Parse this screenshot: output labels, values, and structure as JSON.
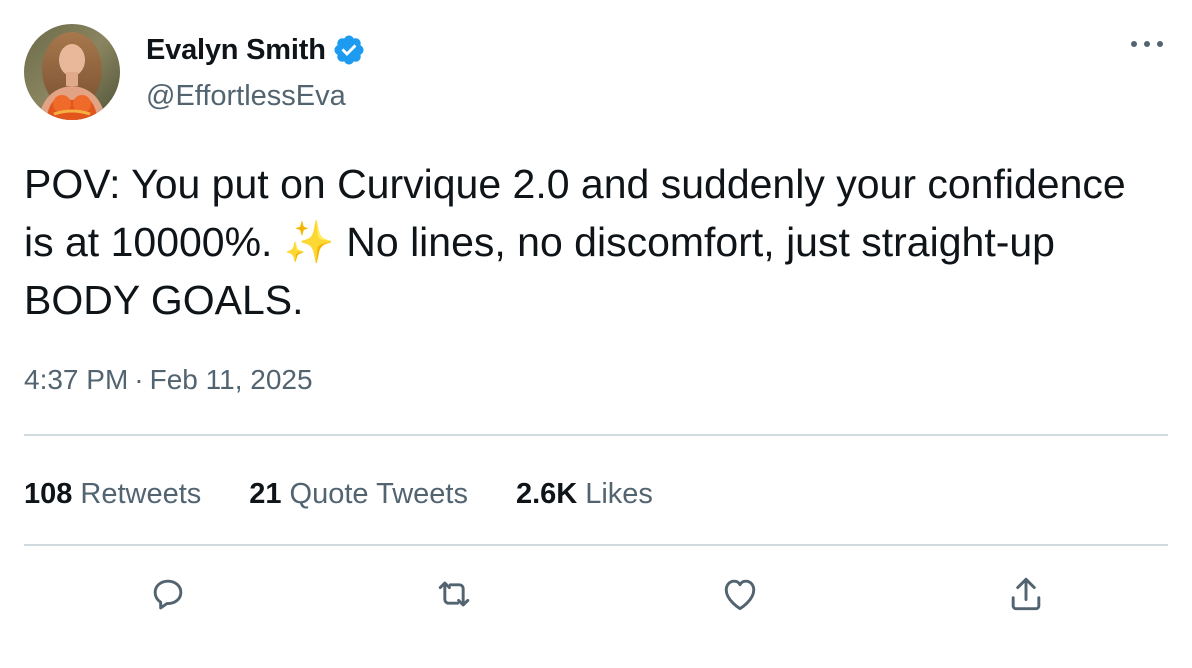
{
  "author": {
    "display_name": "Evalyn Smith",
    "handle": "@EffortlessEva",
    "verified": true
  },
  "tweet": {
    "text": "POV: You put on Curvique 2.0 and suddenly your confidence is at 10000%. ✨ No lines, no discomfort, just straight-up BODY GOALS.",
    "time": "4:37 PM",
    "separator": "·",
    "date": "Feb 11, 2025"
  },
  "stats": {
    "retweets_count": "108",
    "retweets_label": "Retweets",
    "quotes_count": "21",
    "quotes_label": "Quote Tweets",
    "likes_count": "2.6K",
    "likes_label": "Likes"
  },
  "icons": {
    "more": "more-horizontal-icon",
    "verified": "verified-badge-icon",
    "reply": "reply-icon",
    "retweet": "retweet-icon",
    "like": "heart-icon",
    "share": "share-icon"
  },
  "colors": {
    "text_primary": "#0f1419",
    "text_secondary": "#536471",
    "verified_blue": "#1d9bf0",
    "divider": "#cfd9de"
  }
}
